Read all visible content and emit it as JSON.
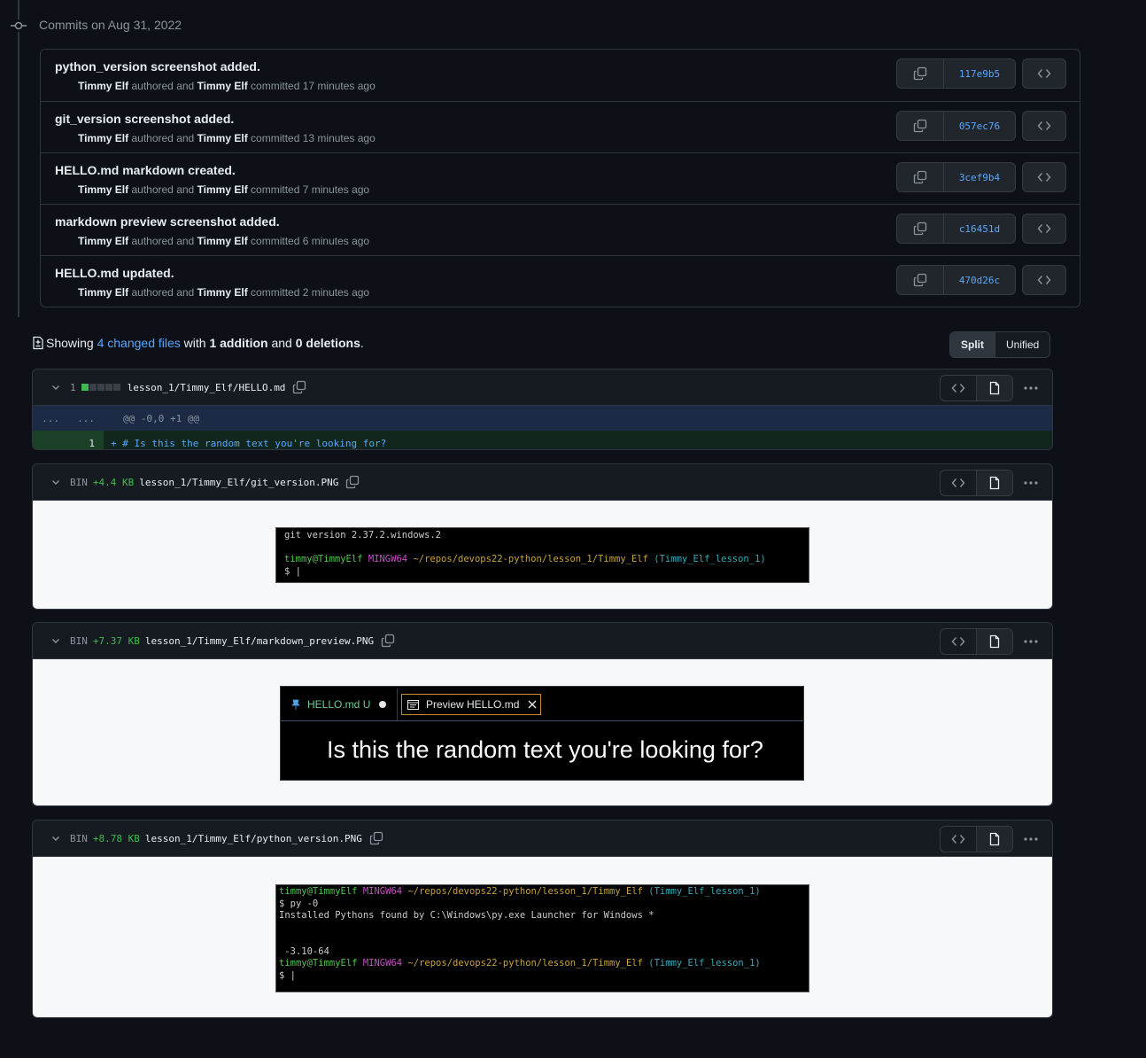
{
  "commits_heading": "Commits on Aug 31, 2022",
  "commits": [
    {
      "title": "python_version screenshot added.",
      "author": "Timmy Elf",
      "authored": "authored and",
      "committer": "Timmy Elf",
      "when": "committed 17 minutes ago",
      "sha": "117e9b5"
    },
    {
      "title": "git_version screenshot added.",
      "author": "Timmy Elf",
      "authored": "authored and",
      "committer": "Timmy Elf",
      "when": "committed 13 minutes ago",
      "sha": "057ec76"
    },
    {
      "title": "HELLO.md markdown created.",
      "author": "Timmy Elf",
      "authored": "authored and",
      "committer": "Timmy Elf",
      "when": "committed 7 minutes ago",
      "sha": "3cef9b4"
    },
    {
      "title": "markdown preview screenshot added.",
      "author": "Timmy Elf",
      "authored": "authored and",
      "committer": "Timmy Elf",
      "when": "committed 6 minutes ago",
      "sha": "c16451d"
    },
    {
      "title": "HELLO.md updated.",
      "author": "Timmy Elf",
      "authored": "authored and",
      "committer": "Timmy Elf",
      "when": "committed 2 minutes ago",
      "sha": "470d26c"
    }
  ],
  "summary": {
    "showing": "Showing",
    "changed_files": "4 changed files",
    "with": "with",
    "additions": "1 addition",
    "and": "and",
    "deletions": "0 deletions",
    "period": "."
  },
  "view_toggle": {
    "split": "Split",
    "unified": "Unified"
  },
  "files": [
    {
      "count": "1",
      "path": "lesson_1/Timmy_Elf/HELLO.md",
      "hunk_left": "...",
      "hunk_right": "...",
      "hunk_header": "@@ -0,0 +1 @@",
      "added_line_no": "1",
      "added_line": "+ # Is this the random text you're looking for?"
    },
    {
      "bin": "BIN",
      "size": "+4.4 KB",
      "path": "lesson_1/Timmy_Elf/git_version.PNG",
      "terminal": {
        "version_line": "git version 2.37.2.windows.2",
        "user": "timmy@TimmyElf",
        "shell": "MINGW64",
        "cwd": "~/repos/devops22-python/lesson_1/Timmy_Elf",
        "branch": "(Timmy_Elf_lesson_1)",
        "prompt": "$ |"
      }
    },
    {
      "bin": "BIN",
      "size": "+7.37 KB",
      "path": "lesson_1/Timmy_Elf/markdown_preview.PNG",
      "preview": {
        "tab1": "HELLO.md U",
        "tab2": "Preview HELLO.md",
        "heading": "Is this the random text you're looking for?"
      }
    },
    {
      "bin": "BIN",
      "size": "+8.78 KB",
      "path": "lesson_1/Timmy_Elf/python_version.PNG",
      "terminal": {
        "user": "timmy@TimmyElf",
        "shell": "MINGW64",
        "cwd": "~/repos/devops22-python/lesson_1/Timmy_Elf",
        "branch": "(Timmy_Elf_lesson_1)",
        "command": "$ py -0",
        "output": "Installed Pythons found by C:\\Windows\\py.exe Launcher for Windows *",
        "version": " -3.10-64",
        "prompt": "$ |"
      }
    }
  ],
  "colors": {
    "link": "#58a6ff",
    "added": "#3fb950",
    "bg": "#0d1117",
    "border": "#30363d"
  },
  "icons": [
    "commit-icon",
    "copy-icon",
    "code-icon",
    "chevron-down-icon",
    "file-icon",
    "kebab-icon",
    "file-diff-icon",
    "close-icon",
    "pin-icon",
    "preview-icon"
  ]
}
